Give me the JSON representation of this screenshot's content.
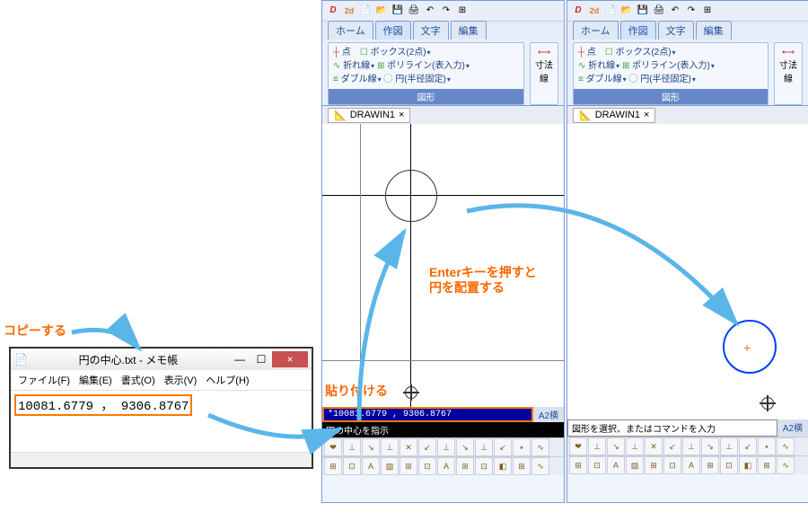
{
  "annotations": {
    "copy": "コピーする",
    "paste": "貼り付ける",
    "enter1": "Enterキーを押すと",
    "enter2": "円を配置する"
  },
  "notepad": {
    "title": "円の中心.txt - メモ帳",
    "menu": {
      "file": "ファイル(F)",
      "edit": "編集(E)",
      "format": "書式(O)",
      "view": "表示(V)",
      "help": "ヘルプ(H)"
    },
    "content": "10081.6779 ， 9306.8767"
  },
  "cad": {
    "tabs": {
      "home": "ホーム",
      "draw": "作図",
      "text": "文字",
      "edit": "編集"
    },
    "ribbon": {
      "point": "点",
      "box": "ボックス(2点)",
      "polyline": "折れ線",
      "poly2": "ポリライン(表入力)",
      "double": "ダブル線",
      "circle": "円(半径固定)",
      "dim": "寸法線",
      "group_shape": "図形"
    },
    "doc_tab": "DRAWIN1",
    "cmd_input": "*10081.6779 , 9306.8767",
    "cmd_hint_left": "円の中心を指示",
    "cmd_hint_right": "図形を選択、またはコマンドを入力",
    "paper": "A2横"
  }
}
